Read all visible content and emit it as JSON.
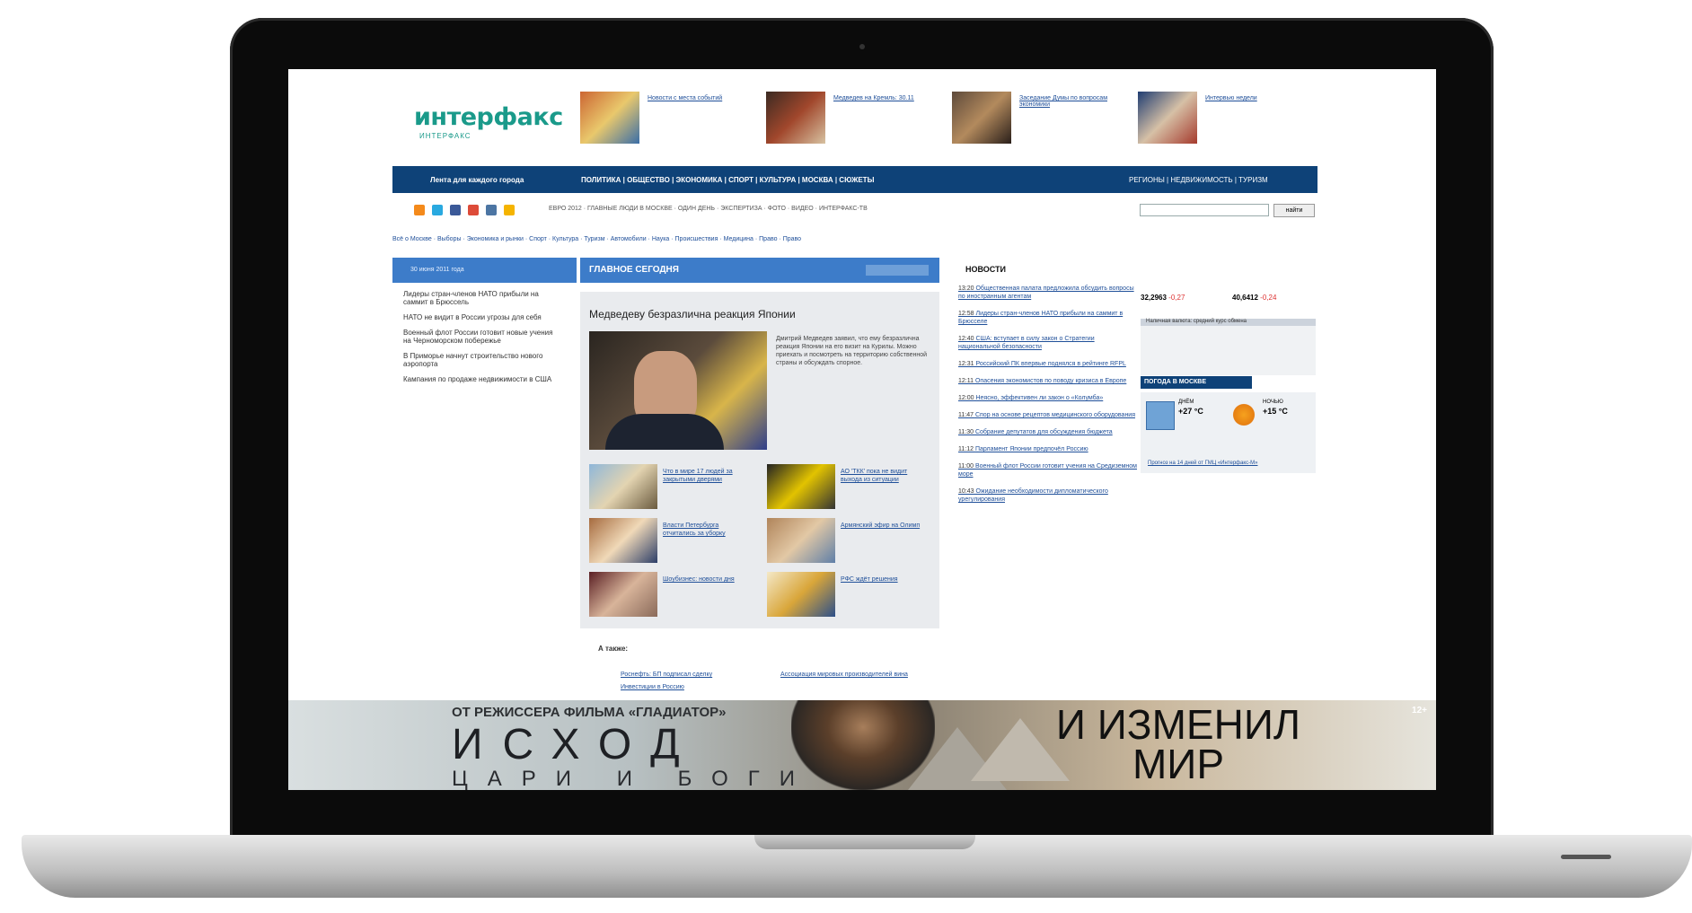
{
  "site": {
    "logo_text": "интерфакс",
    "logo_sub": "ИНТЕРФАКС"
  },
  "top_news": [
    {
      "label": "Новости с места событий"
    },
    {
      "label": "Медведев на Кремль: 30.11"
    },
    {
      "label": "Заседание Думы по вопросам экономики"
    },
    {
      "label": "Интервью недели"
    }
  ],
  "navbar": {
    "region": "Лента для каждого города",
    "sections": "ПОЛИТИКА | ОБЩЕСТВО | ЭКОНОМИКА | СПОРТ | КУЛЬТУРА | МОСКВА | СЮЖЕТЫ",
    "right": "РЕГИОНЫ | НЕДВИЖИМОСТЬ | ТУРИЗМ"
  },
  "sub_links": "ЕВРО 2012  ·  ГЛАВНЫЕ ЛЮДИ В МОСКВЕ  ·  ОДИН ДЕНЬ  ·  ЭКСПЕРТИЗА  ·  ФОТО  ·  ВИДЕО  ·  ИНТЕРФАКС-ТВ",
  "search": {
    "button": "найти"
  },
  "tertiary": "Всё о Москве  ·  Выборы  ·  Экономика и рынки  ·  Спорт  ·  Культура  ·  Туризм  ·  Автомобили  ·  Наука  ·  Происшествия  ·  Медицина  ·  Право  ·  Право",
  "date_bar": {
    "text": "30 июня 2011 года"
  },
  "main_bar": {
    "title": "ГЛАВНОЕ СЕГОДНЯ"
  },
  "left_list": [
    "Лидеры стран-членов НАТО прибыли на саммит в Брюссель",
    "НАТО не видит в России угрозы для себя",
    "Военный флот России готовит новые учения на Черноморском побережье",
    "В Приморье начнут строительство нового аэропорта",
    "Кампания по продаже недвижимости в США"
  ],
  "center": {
    "headline": "Медведеву безразлична реакция Японии",
    "lead": "Дмитрий Медведев заявил, что ему безразлична реакция Японии на его визит на Курилы. Можно приехать и посмотреть на территорию собственной страны и обсуждать спорное.",
    "grid": [
      {
        "label": "Что в мире 17 людей за закрытыми дверями"
      },
      {
        "label": "АО 'ТКК' пока не видит выхода из ситуации"
      },
      {
        "label": "Власти Петербурга отчитались за уборку"
      },
      {
        "label": "Армянский эфир на Олимп"
      },
      {
        "label": "Шоубизнес: новости дня"
      },
      {
        "label": "РФС ждёт решения"
      }
    ]
  },
  "also": {
    "title": "А также:",
    "links": [
      "Роснефть: БП подписал сделку",
      "Инвестиции в Россию",
      "Ассоциация мировых производителей вина"
    ]
  },
  "news": {
    "title": "НОВОСТИ",
    "items": [
      {
        "time": "13:20",
        "text": "Общественная палата предложила обсудить вопросы по иностранным агентам"
      },
      {
        "time": "12:58",
        "text": "Лидеры стран-членов НАТО прибыли на саммит в Брюсселе"
      },
      {
        "time": "12:40",
        "text": "США: вступает в силу закон о Стратегии национальной безопасности"
      },
      {
        "time": "12:31",
        "text": "Российский ПК впервые поднялся в рейтинге RFPL"
      },
      {
        "time": "12:11",
        "text": "Опасения экономистов по поводу кризиса в Европе"
      },
      {
        "time": "12:00",
        "text": "Неясно, эффективен ли закон о «Колумба»"
      },
      {
        "time": "11:47",
        "text": "Спор на основе рецептов медицинского оборудования"
      },
      {
        "time": "11:30",
        "text": "Собрание депутатов для обсуждения бюджета"
      },
      {
        "time": "11:12",
        "text": "Парламент Японии предпочёл Россию"
      },
      {
        "time": "11:00",
        "text": "Военный флот России готовит учения на Средиземном море"
      },
      {
        "time": "10:43",
        "text": "Ожидание необходимости дипломатического урегулирования"
      }
    ]
  },
  "rates": {
    "usd": "32,2963",
    "usd_change": "-0,27",
    "eur": "40,6412",
    "eur_change": "-0,24",
    "table_title": "Наличная валюта: средний курс обмена"
  },
  "weather": {
    "title": "ПОГОДА В МОСКВЕ",
    "day_label": "ДНЁМ",
    "day_temp": "+27 °C",
    "night_label": "НОЧЬЮ",
    "night_temp": "+15 °C",
    "link": "Прогноз на 14 дней от ГМЦ «Интерфакс-М»"
  },
  "ad": {
    "subtitle": "ОТ РЕЖИССЕРА ФИЛЬМА «ГЛАДИАТОР»",
    "title": "ИСХОД",
    "subtitle2": "ЦАРИ И БОГИ",
    "right_text": "И ИЗМЕНИЛ МИР",
    "age": "12+"
  }
}
